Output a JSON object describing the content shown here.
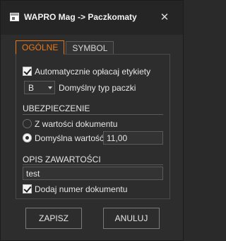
{
  "window": {
    "title": "WAPRO Mag -> Paczkomaty",
    "close_icon": "close-icon"
  },
  "tabs": [
    {
      "label": "OGÓLNE",
      "active": true
    },
    {
      "label": "SYMBOL",
      "active": false
    }
  ],
  "general": {
    "auto_pay_label": "Automatycznie opłacaj etykiety",
    "auto_pay_checked": true,
    "package_type_value": "B",
    "package_type_label": "Domyślny typ paczki"
  },
  "insurance": {
    "title": "UBEZPIECZENIE",
    "from_document_label": "Z wartości dokumentu",
    "from_document_selected": false,
    "default_value_label": "Domyślna wartość:",
    "default_value_selected": true,
    "default_value": "11,00"
  },
  "contents": {
    "title": "OPIS ZAWARTOŚCI",
    "value": "test",
    "add_doc_number_label": "Dodaj numer dokumentu",
    "add_doc_number_checked": true
  },
  "buttons": {
    "save_label": "ZAPISZ",
    "cancel_label": "ANULUJ"
  }
}
